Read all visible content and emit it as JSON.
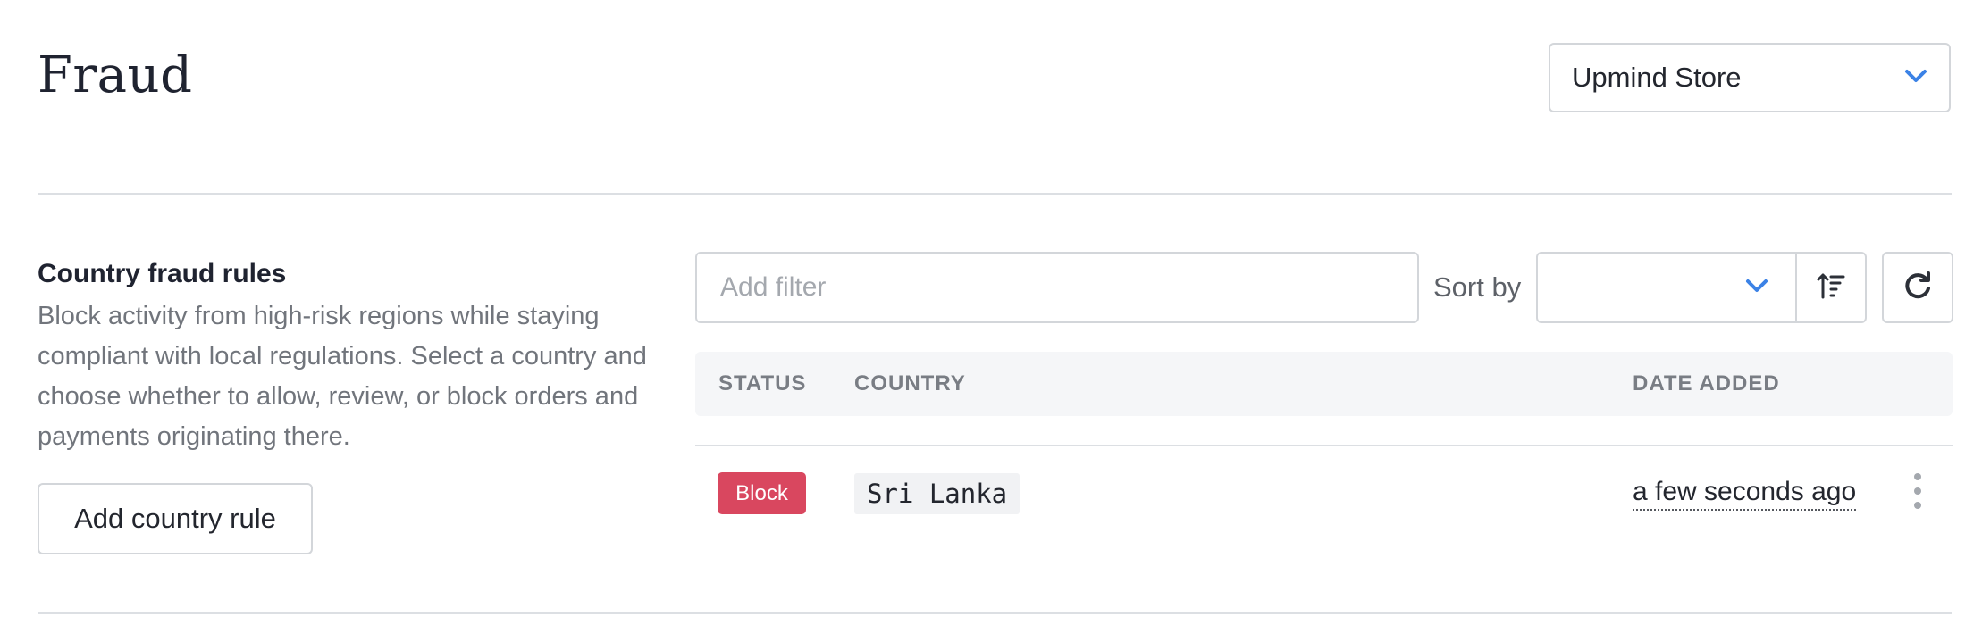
{
  "header": {
    "title": "Fraud",
    "store_selector": {
      "selected": "Upmind Store",
      "icon": "chevron-down-icon"
    }
  },
  "section": {
    "title": "Country fraud rules",
    "description": "Block activity from high-risk regions while staying compliant with local regulations. Select a country and choose whether to allow, review, or block orders and payments originating there.",
    "add_button_label": "Add country rule"
  },
  "toolbar": {
    "filter_placeholder": "Add filter",
    "filter_value": "",
    "sort_label": "Sort by",
    "sort_selected": "",
    "sort_order_icon": "sort-ascending-icon",
    "refresh_icon": "refresh-icon"
  },
  "table": {
    "columns": [
      "STATUS",
      "COUNTRY",
      "DATE ADDED"
    ],
    "rows": [
      {
        "status": "Block",
        "country": "Sri Lanka",
        "date_added": "a few seconds ago"
      }
    ]
  },
  "colors": {
    "accent": "#3b82e6",
    "block_badge": "#d9475f",
    "border": "#d3d6da",
    "muted_text": "#71757c",
    "header_bg": "#f5f6f8"
  }
}
